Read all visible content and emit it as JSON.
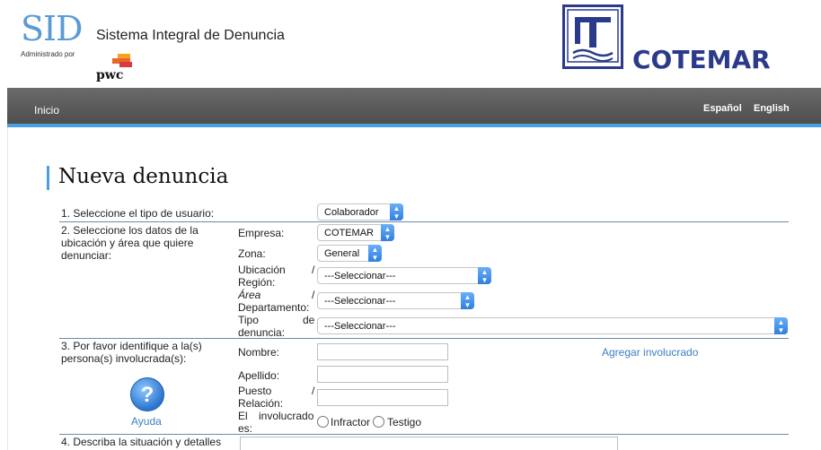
{
  "header": {
    "logo_text": "SID",
    "admin_text": "Administrado por",
    "pwc_text": "pwc",
    "system_title": "Sistema Integral de Denuncia",
    "brand": "COTEMAR"
  },
  "nav": {
    "home": "Inicio",
    "lang_es": "Español",
    "lang_en": "English"
  },
  "page_title": "Nueva denuncia",
  "form": {
    "step1": {
      "label": "1. Seleccione el tipo de usuario:",
      "value": "Colaborador"
    },
    "step2": {
      "label_line1": "2. Seleccione los datos de la",
      "label_line2": "ubicación y área que quiere",
      "label_line3": "denunciar:",
      "empresa_label": "Empresa:",
      "empresa_value": "COTEMAR",
      "zona_label": "Zona:",
      "zona_value": "General",
      "ubicacion_label_1": "Ubicación",
      "ubicacion_label_sep": "/",
      "ubicacion_label_2": "Región:",
      "ubicacion_value": "---Seleccionar---",
      "area_label_1": "Área",
      "area_label_sep": "/",
      "area_label_2": "Departamento:",
      "area_value": "---Seleccionar---",
      "tipo_label_1": "Tipo",
      "tipo_label_de": "de",
      "tipo_label_2": "denuncia:",
      "tipo_value": "---Seleccionar---"
    },
    "step3": {
      "label_line1": "3. Por favor identifique a la(s)",
      "label_line2": "persona(s) involucrada(s):",
      "nombre_label": "Nombre:",
      "apellido_label": "Apellido:",
      "puesto_label_1": "Puesto",
      "puesto_label_sep": "/",
      "puesto_label_2": "Relación:",
      "involucrado_label_1": "El",
      "involucrado_label_2": "involucrado",
      "involucrado_label_3": "es:",
      "option_infractor": "Infractor",
      "option_testigo": "Testigo",
      "add_link": "Agregar involucrado",
      "help_label": "Ayuda",
      "help_glyph": "?"
    },
    "step4": {
      "label": "4. Describa la situación y detalles"
    }
  },
  "colors": {
    "accent": "#4a9ee8",
    "brand": "#2b3a8a",
    "link": "#3c7fc1"
  }
}
